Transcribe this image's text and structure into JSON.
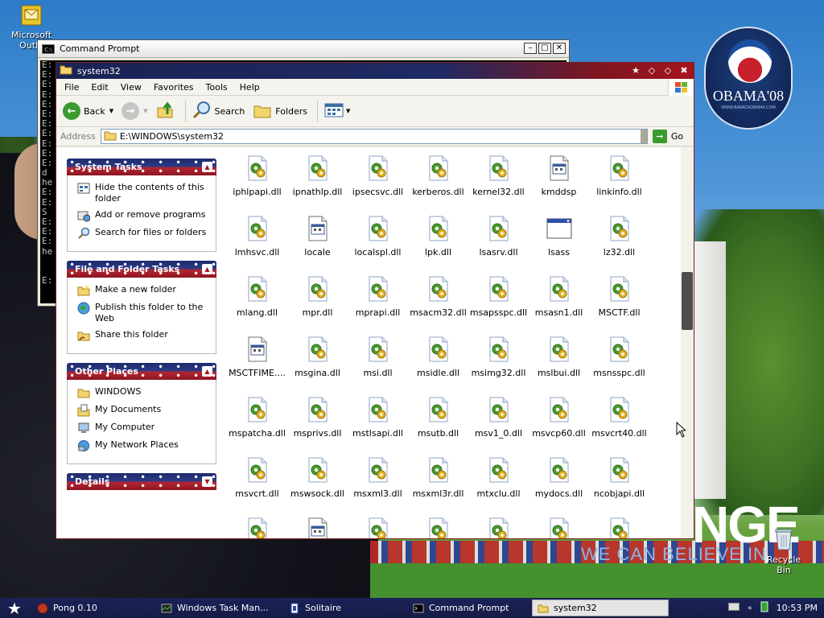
{
  "desktop": {
    "outlook_icon": {
      "line1": "Microsoft",
      "line2": "Outlo"
    },
    "recycle_bin": "Recycle Bin",
    "wallpaper": {
      "logo_word": "OBAMA'08",
      "logo_url": "WWW.BARACKOBAMA.COM",
      "change_text": "NGE",
      "believe_text": "WE CAN BELIEVE IN"
    }
  },
  "cmd": {
    "title": "Command Prompt",
    "lines": [
      "E:",
      "E:",
      "E:",
      "E:",
      "E:",
      "E:",
      "E:",
      "E:",
      "E:",
      "E:",
      "E:",
      "d",
      "he",
      "E:",
      "E:",
      "S",
      "E:",
      "E:",
      "E:",
      "he",
      "",
      "",
      "E:"
    ]
  },
  "explorer": {
    "title": "system32",
    "menu": [
      "File",
      "Edit",
      "View",
      "Favorites",
      "Tools",
      "Help"
    ],
    "toolbar": {
      "back": "Back",
      "search": "Search",
      "folders": "Folders"
    },
    "address": {
      "label": "Address",
      "path": "E:\\WINDOWS\\system32",
      "go": "Go"
    },
    "tasks": [
      {
        "title": "System Tasks",
        "items": [
          {
            "icon": "hide-contents-icon",
            "label": "Hide the contents of this folder"
          },
          {
            "icon": "add-remove-programs-icon",
            "label": "Add or remove programs"
          },
          {
            "icon": "search-files-icon",
            "label": "Search for files or folders"
          }
        ]
      },
      {
        "title": "File and Folder Tasks",
        "items": [
          {
            "icon": "new-folder-icon",
            "label": "Make a new folder"
          },
          {
            "icon": "publish-web-icon",
            "label": "Publish this folder to the Web"
          },
          {
            "icon": "share-folder-icon",
            "label": "Share this folder"
          }
        ]
      },
      {
        "title": "Other Places",
        "items": [
          {
            "icon": "folder-icon",
            "label": "WINDOWS"
          },
          {
            "icon": "my-documents-icon",
            "label": "My Documents"
          },
          {
            "icon": "my-computer-icon",
            "label": "My Computer"
          },
          {
            "icon": "network-places-icon",
            "label": "My Network Places"
          }
        ]
      },
      {
        "title": "Details",
        "items": []
      }
    ],
    "files": [
      {
        "name": "iphlpapi.dll",
        "kind": "dll"
      },
      {
        "name": "ipnathlp.dll",
        "kind": "dll"
      },
      {
        "name": "ipsecsvc.dll",
        "kind": "dll"
      },
      {
        "name": "kerberos.dll",
        "kind": "dll"
      },
      {
        "name": "kernel32.dll",
        "kind": "dll"
      },
      {
        "name": "kmddsp",
        "kind": "doc"
      },
      {
        "name": "linkinfo.dll",
        "kind": "dll"
      },
      {
        "name": "lmhsvc.dll",
        "kind": "dll"
      },
      {
        "name": "locale",
        "kind": "doc"
      },
      {
        "name": "localspl.dll",
        "kind": "dll"
      },
      {
        "name": "lpk.dll",
        "kind": "dll"
      },
      {
        "name": "lsasrv.dll",
        "kind": "dll"
      },
      {
        "name": "lsass",
        "kind": "exe"
      },
      {
        "name": "lz32.dll",
        "kind": "dll"
      },
      {
        "name": "mlang.dll",
        "kind": "dll"
      },
      {
        "name": "mpr.dll",
        "kind": "dll"
      },
      {
        "name": "mprapi.dll",
        "kind": "dll"
      },
      {
        "name": "msacm32.dll",
        "kind": "dll"
      },
      {
        "name": "msapsspc.dll",
        "kind": "dll"
      },
      {
        "name": "msasn1.dll",
        "kind": "dll"
      },
      {
        "name": "MSCTF.dll",
        "kind": "dll"
      },
      {
        "name": "MSCTFIME....",
        "kind": "doc"
      },
      {
        "name": "msgina.dll",
        "kind": "dll"
      },
      {
        "name": "msi.dll",
        "kind": "dll"
      },
      {
        "name": "msidle.dll",
        "kind": "dll"
      },
      {
        "name": "msimg32.dll",
        "kind": "dll"
      },
      {
        "name": "mslbui.dll",
        "kind": "dll"
      },
      {
        "name": "msnsspc.dll",
        "kind": "dll"
      },
      {
        "name": "mspatcha.dll",
        "kind": "dll"
      },
      {
        "name": "msprivs.dll",
        "kind": "dll"
      },
      {
        "name": "mstlsapi.dll",
        "kind": "dll"
      },
      {
        "name": "msutb.dll",
        "kind": "dll"
      },
      {
        "name": "msv1_0.dll",
        "kind": "dll"
      },
      {
        "name": "msvcp60.dll",
        "kind": "dll"
      },
      {
        "name": "msvcrt40.dll",
        "kind": "dll"
      },
      {
        "name": "msvcrt.dll",
        "kind": "dll"
      },
      {
        "name": "mswsock.dll",
        "kind": "dll"
      },
      {
        "name": "msxml3.dll",
        "kind": "dll"
      },
      {
        "name": "msxml3r.dll",
        "kind": "dll"
      },
      {
        "name": "mtxclu.dll",
        "kind": "dll"
      },
      {
        "name": "mydocs.dll",
        "kind": "dll"
      },
      {
        "name": "ncobjapi.dll",
        "kind": "dll"
      },
      {
        "name": "",
        "kind": "dll"
      },
      {
        "name": "",
        "kind": "doc"
      },
      {
        "name": "",
        "kind": "dll"
      },
      {
        "name": "",
        "kind": "dll"
      },
      {
        "name": "",
        "kind": "dll"
      },
      {
        "name": "",
        "kind": "dll"
      },
      {
        "name": "",
        "kind": "dll"
      }
    ]
  },
  "taskbar": {
    "tasks": [
      {
        "label": "Pong 0.10",
        "icon": "pong-icon",
        "active": false
      },
      {
        "label": "Windows Task Man...",
        "icon": "task-manager-icon",
        "active": false
      },
      {
        "label": "Solitaire",
        "icon": "solitaire-icon",
        "active": false
      },
      {
        "label": "Command Prompt",
        "icon": "cmd-icon",
        "active": false
      },
      {
        "label": "system32",
        "icon": "folder-icon",
        "active": true
      }
    ],
    "clock": "10:53 PM"
  },
  "colors": {
    "accent_blue": "#1e2a6b",
    "accent_red": "#b32632",
    "dll_gear_green": "#4a9a2f",
    "dll_gear_yellow": "#e3b21e"
  }
}
